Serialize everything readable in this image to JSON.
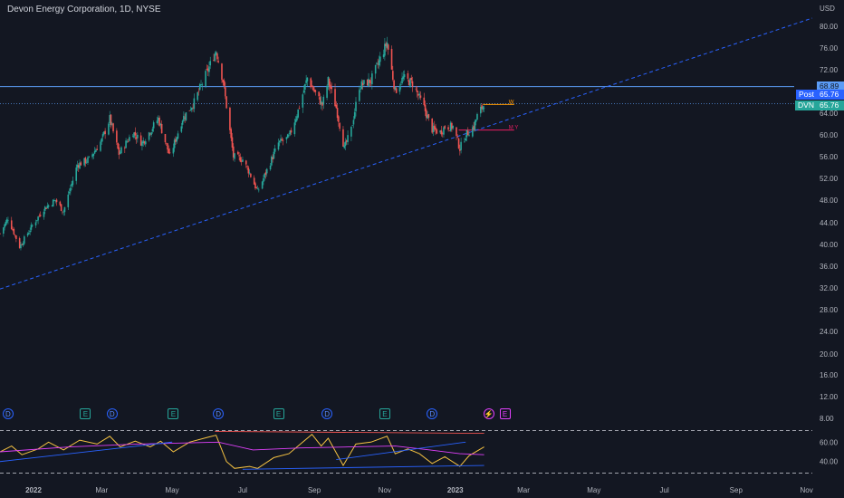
{
  "title": "Devon Energy Corporation, 1D, NYSE",
  "currency": "USD",
  "colors": {
    "background": "#131722",
    "up": "#26a69a",
    "down": "#ef5350",
    "trendline": "#2962ff",
    "hline": "#5b9cf6",
    "rsi": "#f5c242",
    "rsi_ma": "#e040fb",
    "w_level": "#ff9800",
    "my_level": "#e91e63"
  },
  "price_tags": [
    {
      "label": "",
      "value": "68.89",
      "bg": "#5b9cf6",
      "fg": "#131722"
    },
    {
      "label": "Post",
      "value": "65.76",
      "bg": "#2962ff",
      "fg": "#ffffff"
    },
    {
      "label": "DVN",
      "value": "65.76",
      "bg": "#26a69a",
      "fg": "#ffffff"
    }
  ],
  "level_labels": {
    "w": "W",
    "my": "M Y"
  },
  "events": [
    {
      "type": "D",
      "date": "2021-12-10"
    },
    {
      "type": "E",
      "date": "2022-02-15"
    },
    {
      "type": "D",
      "date": "2022-03-10"
    },
    {
      "type": "E",
      "date": "2022-05-02"
    },
    {
      "type": "D",
      "date": "2022-06-10"
    },
    {
      "type": "E",
      "date": "2022-08-01"
    },
    {
      "type": "D",
      "date": "2022-09-12"
    },
    {
      "type": "E",
      "date": "2022-11-01"
    },
    {
      "type": "D",
      "date": "2022-12-12"
    },
    {
      "type": "split",
      "date": "2023-01-30"
    },
    {
      "type": "E",
      "date": "2023-02-13"
    }
  ],
  "chart_data": [
    {
      "type": "candlestick",
      "title": "Devon Energy Corporation, 1D, NYSE",
      "y_scale": "log",
      "ylim": [
        8,
        84
      ],
      "y_ticks": [
        8,
        12,
        16,
        20,
        24,
        28,
        32,
        36,
        40,
        44,
        48,
        52,
        56,
        60,
        64,
        68,
        72,
        76,
        80
      ],
      "x_range": [
        "2021-12-03",
        "2023-11-06"
      ],
      "x_tick_labels": [
        {
          "label": "2022",
          "date": "2022-01-01"
        },
        {
          "label": "Mar",
          "date": "2022-03-01"
        },
        {
          "label": "May",
          "date": "2022-05-01"
        },
        {
          "label": "Jul",
          "date": "2022-07-01"
        },
        {
          "label": "Sep",
          "date": "2022-09-01"
        },
        {
          "label": "Nov",
          "date": "2022-11-01"
        },
        {
          "label": "2023",
          "date": "2023-01-01"
        },
        {
          "label": "Mar",
          "date": "2023-03-01"
        },
        {
          "label": "May",
          "date": "2023-05-01"
        },
        {
          "label": "Jul",
          "date": "2023-07-01"
        },
        {
          "label": "Sep",
          "date": "2023-09-01"
        },
        {
          "label": "Nov",
          "date": "2023-11-01"
        }
      ],
      "price_anchors": [
        [
          "2021-12-03",
          42.0
        ],
        [
          "2021-12-10",
          44.8
        ],
        [
          "2021-12-20",
          39.6
        ],
        [
          "2021-12-31",
          43.5
        ],
        [
          "2022-01-10",
          46.5
        ],
        [
          "2022-01-20",
          48.0
        ],
        [
          "2022-01-27",
          46.0
        ],
        [
          "2022-02-08",
          54.5
        ],
        [
          "2022-02-18",
          55.5
        ],
        [
          "2022-03-01",
          59.0
        ],
        [
          "2022-03-08",
          63.0
        ],
        [
          "2022-03-16",
          56.5
        ],
        [
          "2022-03-28",
          60.5
        ],
        [
          "2022-04-05",
          58.5
        ],
        [
          "2022-04-19",
          63.0
        ],
        [
          "2022-04-29",
          56.0
        ],
        [
          "2022-05-10",
          63.0
        ],
        [
          "2022-05-20",
          66.0
        ],
        [
          "2022-06-01",
          72.0
        ],
        [
          "2022-06-08",
          75.5
        ],
        [
          "2022-06-14",
          70.0
        ],
        [
          "2022-06-23",
          56.0
        ],
        [
          "2022-07-01",
          55.5
        ],
        [
          "2022-07-07",
          53.0
        ],
        [
          "2022-07-14",
          49.5
        ],
        [
          "2022-07-25",
          55.0
        ],
        [
          "2022-08-01",
          58.5
        ],
        [
          "2022-08-10",
          59.5
        ],
        [
          "2022-08-18",
          64.5
        ],
        [
          "2022-08-26",
          70.5
        ],
        [
          "2022-09-01",
          68.0
        ],
        [
          "2022-09-08",
          65.5
        ],
        [
          "2022-09-13",
          70.0
        ],
        [
          "2022-09-20",
          65.0
        ],
        [
          "2022-09-27",
          57.5
        ],
        [
          "2022-10-03",
          61.0
        ],
        [
          "2022-10-10",
          69.0
        ],
        [
          "2022-10-20",
          70.0
        ],
        [
          "2022-10-28",
          74.0
        ],
        [
          "2022-11-03",
          77.0
        ],
        [
          "2022-11-10",
          68.0
        ],
        [
          "2022-11-17",
          70.5
        ],
        [
          "2022-11-25",
          69.5
        ],
        [
          "2022-12-05",
          65.0
        ],
        [
          "2022-12-12",
          61.0
        ],
        [
          "2022-12-19",
          60.5
        ],
        [
          "2022-12-23",
          61.5
        ],
        [
          "2022-12-30",
          61.5
        ],
        [
          "2023-01-05",
          57.5
        ],
        [
          "2023-01-10",
          60.0
        ],
        [
          "2023-01-17",
          61.5
        ],
        [
          "2023-01-20",
          63.5
        ],
        [
          "2023-01-26",
          65.76
        ]
      ],
      "horizontal_levels": [
        {
          "name": "",
          "value": 68.89,
          "extent": "full"
        },
        {
          "name": "",
          "value": 65.76,
          "extent": "full",
          "style": "dotted"
        },
        {
          "name": "W",
          "value": 65.6,
          "from": "2023-01-25",
          "to": "2023-02-21"
        },
        {
          "name": "M Y",
          "value": 60.9,
          "from": "2023-01-04",
          "to": "2023-02-21"
        }
      ],
      "trendlines": [
        {
          "from": [
            "2021-12-03",
            31.8
          ],
          "to": [
            "2023-11-06",
            81.5
          ],
          "style": "dashed"
        }
      ]
    },
    {
      "type": "line",
      "panel": "oscillator",
      "ylim": [
        23,
        77
      ],
      "y_ticks": [
        40,
        60
      ],
      "bands": [
        72,
        28
      ],
      "series": [
        {
          "name": "",
          "color": "#f5c242",
          "points": [
            [
              "2021-12-03",
              50
            ],
            [
              "2021-12-13",
              56
            ],
            [
              "2021-12-22",
              47
            ],
            [
              "2022-01-05",
              53
            ],
            [
              "2022-01-14",
              60
            ],
            [
              "2022-01-27",
              52
            ],
            [
              "2022-02-10",
              62
            ],
            [
              "2022-02-25",
              58
            ],
            [
              "2022-03-08",
              66
            ],
            [
              "2022-03-17",
              55
            ],
            [
              "2022-03-30",
              61
            ],
            [
              "2022-04-12",
              55
            ],
            [
              "2022-04-21",
              61
            ],
            [
              "2022-05-02",
              50
            ],
            [
              "2022-05-16",
              60
            ],
            [
              "2022-06-01",
              65
            ],
            [
              "2022-06-08",
              67
            ],
            [
              "2022-06-17",
              40
            ],
            [
              "2022-06-24",
              33
            ],
            [
              "2022-07-07",
              35
            ],
            [
              "2022-07-14",
              33
            ],
            [
              "2022-07-28",
              44
            ],
            [
              "2022-08-10",
              48
            ],
            [
              "2022-08-22",
              60
            ],
            [
              "2022-08-30",
              68
            ],
            [
              "2022-09-07",
              56
            ],
            [
              "2022-09-13",
              64
            ],
            [
              "2022-09-26",
              36
            ],
            [
              "2022-10-07",
              58
            ],
            [
              "2022-10-20",
              60
            ],
            [
              "2022-11-03",
              66
            ],
            [
              "2022-11-10",
              48
            ],
            [
              "2022-11-21",
              53
            ],
            [
              "2022-12-01",
              48
            ],
            [
              "2022-12-12",
              38
            ],
            [
              "2022-12-23",
              45
            ],
            [
              "2023-01-05",
              35
            ],
            [
              "2023-01-13",
              46
            ],
            [
              "2023-01-26",
              55
            ]
          ]
        },
        {
          "name": "",
          "color": "#e040fb",
          "points": [
            [
              "2021-12-03",
              50
            ],
            [
              "2022-02-01",
              55
            ],
            [
              "2022-04-01",
              58
            ],
            [
              "2022-06-10",
              60
            ],
            [
              "2022-07-10",
              52
            ],
            [
              "2022-08-20",
              54
            ],
            [
              "2022-10-01",
              55
            ],
            [
              "2022-11-10",
              56
            ],
            [
              "2022-12-10",
              52
            ],
            [
              "2023-01-05",
              48
            ],
            [
              "2023-01-26",
              47
            ]
          ]
        }
      ],
      "trendlines": [
        {
          "from": [
            "2022-06-07",
            71
          ],
          "to": [
            "2023-01-26",
            69
          ],
          "color": "#ef5350"
        },
        {
          "from": [
            "2022-07-01",
            32
          ],
          "to": [
            "2023-01-26",
            36
          ],
          "color": "#2962ff"
        },
        {
          "from": [
            "2021-12-03",
            40
          ],
          "to": [
            "2022-05-01",
            60
          ],
          "color": "#2962ff"
        },
        {
          "from": [
            "2022-09-20",
            42
          ],
          "to": [
            "2023-01-10",
            60
          ],
          "color": "#2962ff"
        }
      ]
    }
  ]
}
